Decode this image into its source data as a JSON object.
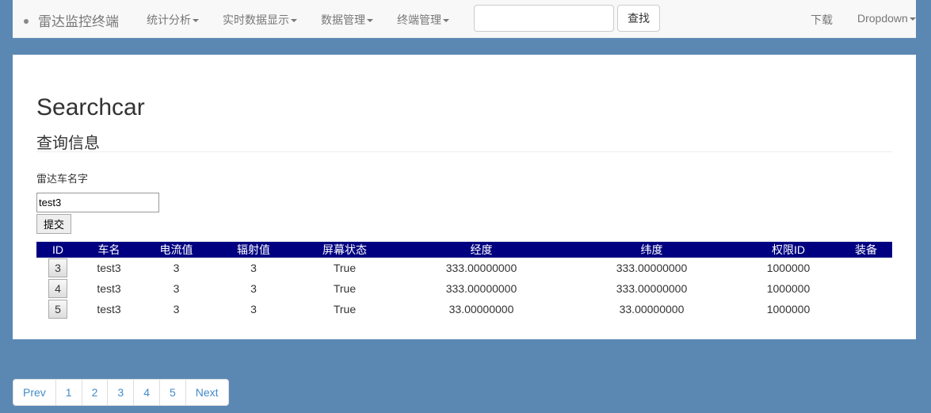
{
  "nav": {
    "brand": "雷达监控终端",
    "menus": [
      "统计分析",
      "实时数据显示",
      "数据管理",
      "终端管理"
    ],
    "search_value": "",
    "search_button": "查找",
    "download": "下载",
    "dropdown": "Dropdown"
  },
  "main": {
    "title": "Searchcar",
    "subtitle": "查询信息",
    "field_label": "雷达车名字",
    "field_value": "test3",
    "submit": "提交"
  },
  "table": {
    "headers": [
      "ID",
      "车名",
      "电流值",
      "辐射值",
      "屏幕状态",
      "经度",
      "纬度",
      "权限ID",
      "装备"
    ],
    "rows": [
      [
        "3",
        "test3",
        "3",
        "3",
        "True",
        "333.00000000",
        "333.00000000",
        "1000000",
        ""
      ],
      [
        "4",
        "test3",
        "3",
        "3",
        "True",
        "333.00000000",
        "333.00000000",
        "1000000",
        ""
      ],
      [
        "5",
        "test3",
        "3",
        "3",
        "True",
        "33.00000000",
        "33.00000000",
        "1000000",
        ""
      ]
    ]
  },
  "pagination": [
    "Prev",
    "1",
    "2",
    "3",
    "4",
    "5",
    "Next"
  ]
}
